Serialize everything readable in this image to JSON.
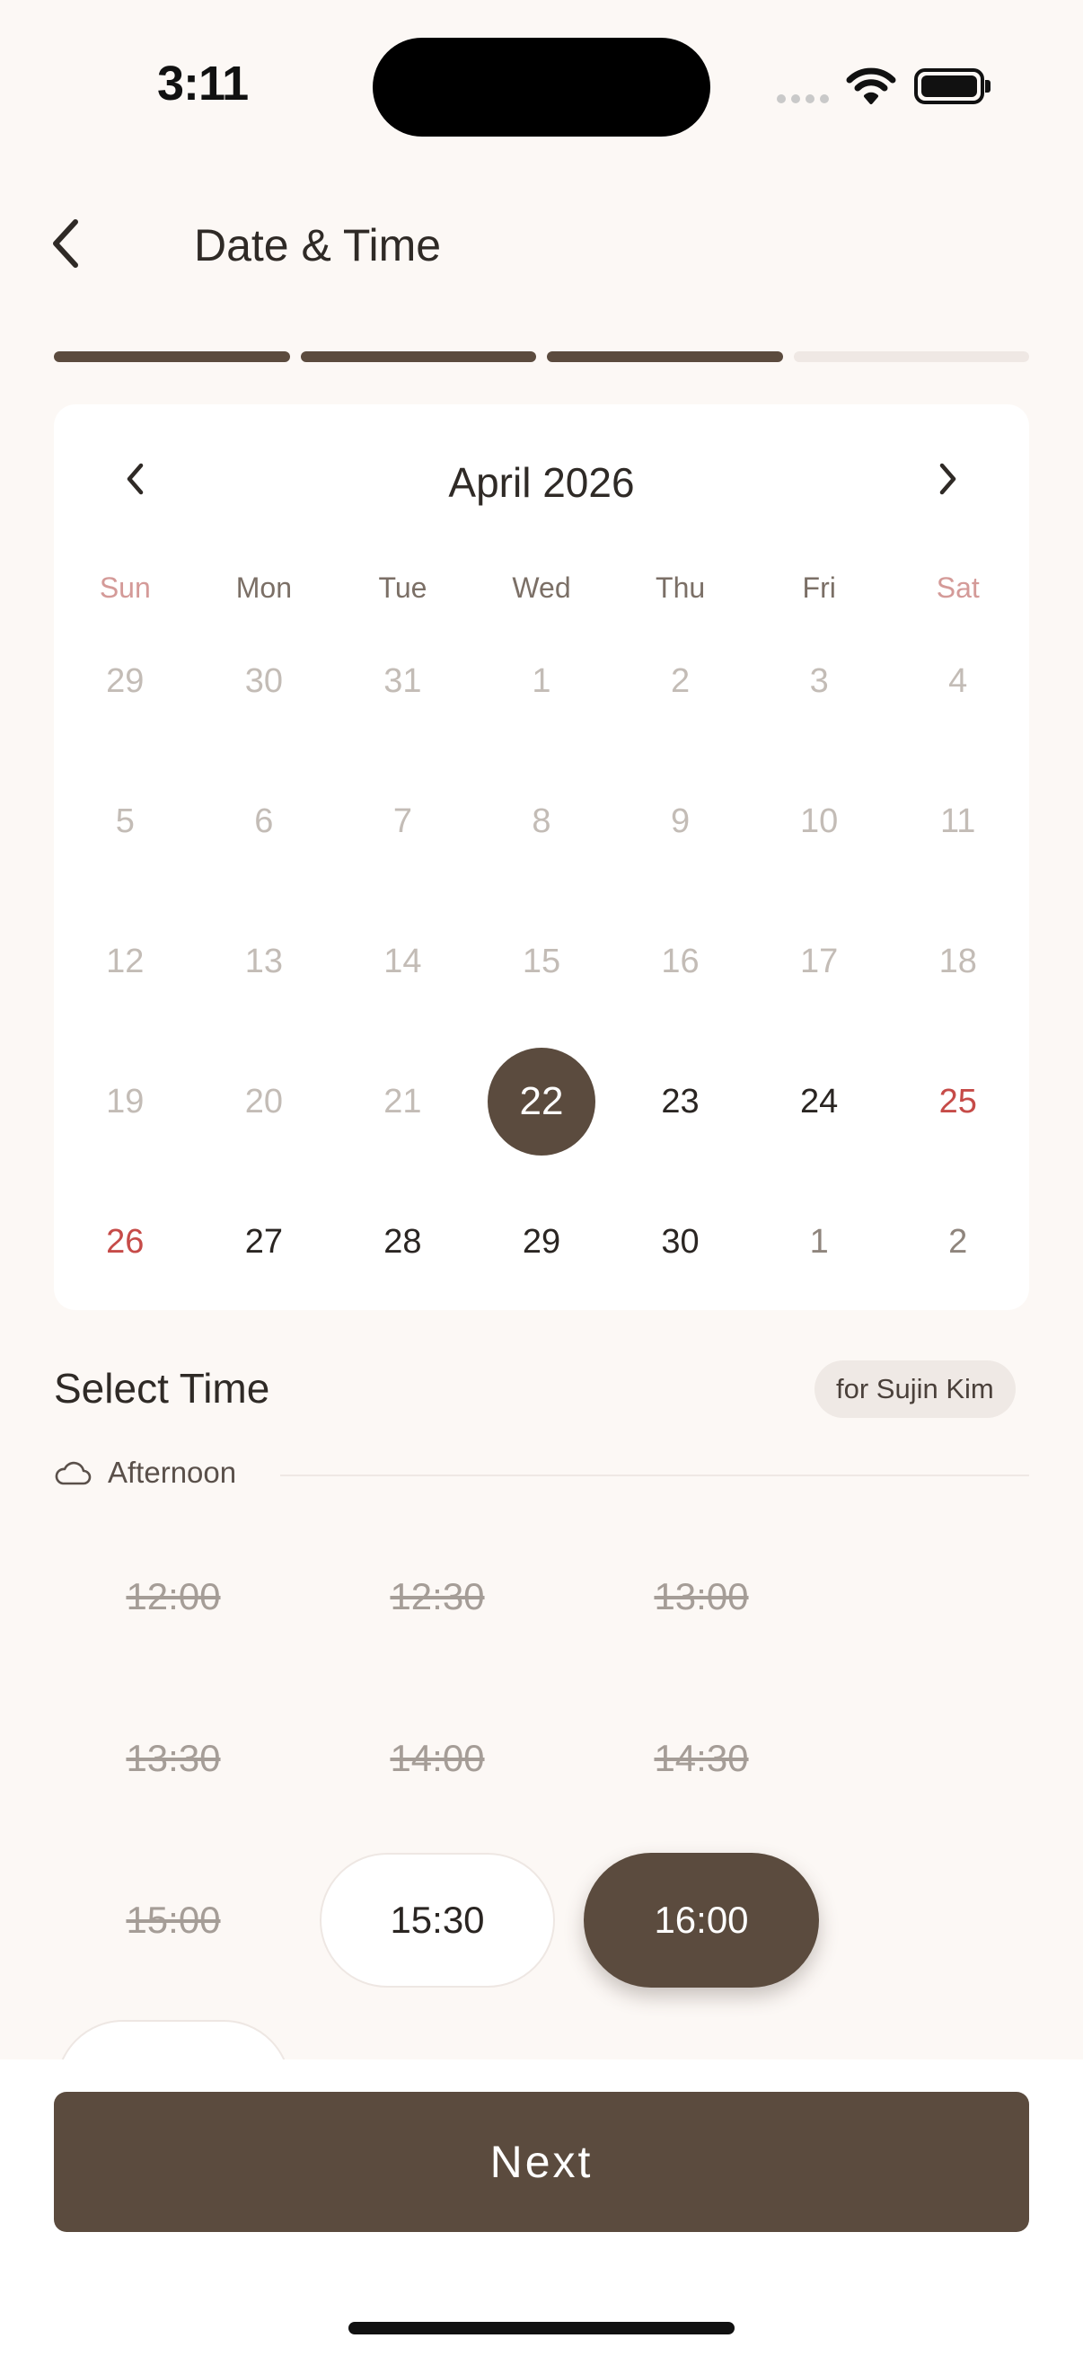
{
  "status_bar": {
    "time": "3:11"
  },
  "header": {
    "title": "Date & Time"
  },
  "progress": {
    "steps_total": 4,
    "steps_completed": 3
  },
  "calendar": {
    "month_label": "April 2026",
    "weekdays": [
      "Sun",
      "Mon",
      "Tue",
      "Wed",
      "Thu",
      "Fri",
      "Sat"
    ],
    "days": [
      {
        "label": "29",
        "state": "disabled"
      },
      {
        "label": "30",
        "state": "disabled"
      },
      {
        "label": "31",
        "state": "disabled"
      },
      {
        "label": "1",
        "state": "disabled"
      },
      {
        "label": "2",
        "state": "disabled"
      },
      {
        "label": "3",
        "state": "disabled"
      },
      {
        "label": "4",
        "state": "disabled"
      },
      {
        "label": "5",
        "state": "disabled"
      },
      {
        "label": "6",
        "state": "disabled"
      },
      {
        "label": "7",
        "state": "disabled"
      },
      {
        "label": "8",
        "state": "disabled"
      },
      {
        "label": "9",
        "state": "disabled"
      },
      {
        "label": "10",
        "state": "disabled"
      },
      {
        "label": "11",
        "state": "disabled"
      },
      {
        "label": "12",
        "state": "disabled"
      },
      {
        "label": "13",
        "state": "disabled"
      },
      {
        "label": "14",
        "state": "disabled"
      },
      {
        "label": "15",
        "state": "disabled"
      },
      {
        "label": "16",
        "state": "disabled"
      },
      {
        "label": "17",
        "state": "disabled"
      },
      {
        "label": "18",
        "state": "disabled"
      },
      {
        "label": "19",
        "state": "disabled"
      },
      {
        "label": "20",
        "state": "disabled"
      },
      {
        "label": "21",
        "state": "disabled"
      },
      {
        "label": "22",
        "state": "selected"
      },
      {
        "label": "23",
        "state": "available"
      },
      {
        "label": "24",
        "state": "available"
      },
      {
        "label": "25",
        "state": "holiday"
      },
      {
        "label": "26",
        "state": "holiday"
      },
      {
        "label": "27",
        "state": "available"
      },
      {
        "label": "28",
        "state": "available"
      },
      {
        "label": "29",
        "state": "available"
      },
      {
        "label": "30",
        "state": "available"
      },
      {
        "label": "1",
        "state": "next-month"
      },
      {
        "label": "2",
        "state": "next-month"
      }
    ]
  },
  "time_section": {
    "title": "Select Time",
    "for_label": "for Sujin Kim",
    "period_label": "Afternoon",
    "slots": [
      {
        "label": "12:00",
        "state": "unavailable"
      },
      {
        "label": "12:30",
        "state": "unavailable"
      },
      {
        "label": "13:00",
        "state": "unavailable"
      },
      {
        "label": "13:30",
        "state": "unavailable"
      },
      {
        "label": "14:00",
        "state": "unavailable"
      },
      {
        "label": "14:30",
        "state": "unavailable"
      },
      {
        "label": "15:00",
        "state": "unavailable"
      },
      {
        "label": "15:30",
        "state": "available"
      },
      {
        "label": "16:00",
        "state": "selected"
      }
    ]
  },
  "footer": {
    "next_label": "Next"
  },
  "colors": {
    "accent": "#5b4b3e",
    "holiday": "#c64b48",
    "background": "#fcf8f5"
  },
  "icons": [
    "chevron-left-icon",
    "cloud-icon",
    "wifi-icon",
    "battery-icon"
  ]
}
